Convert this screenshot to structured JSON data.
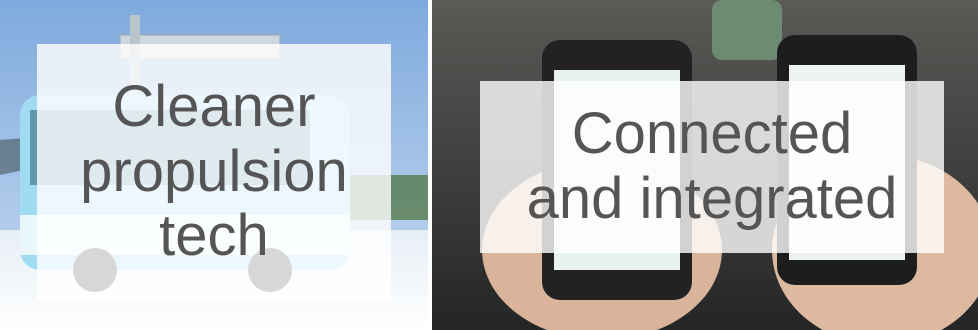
{
  "tiles": [
    {
      "image": "electric-bus-at-charging-station-photo",
      "caption_lines": [
        "Cleaner",
        "propulsion",
        "tech"
      ]
    },
    {
      "image": "hands-holding-smartphones-photo",
      "caption_lines": [
        "Connected",
        "and integrated"
      ]
    }
  ],
  "colors": {
    "caption_text": "#555555",
    "caption_backdrop": "rgba(255,255,255,0.80)"
  }
}
